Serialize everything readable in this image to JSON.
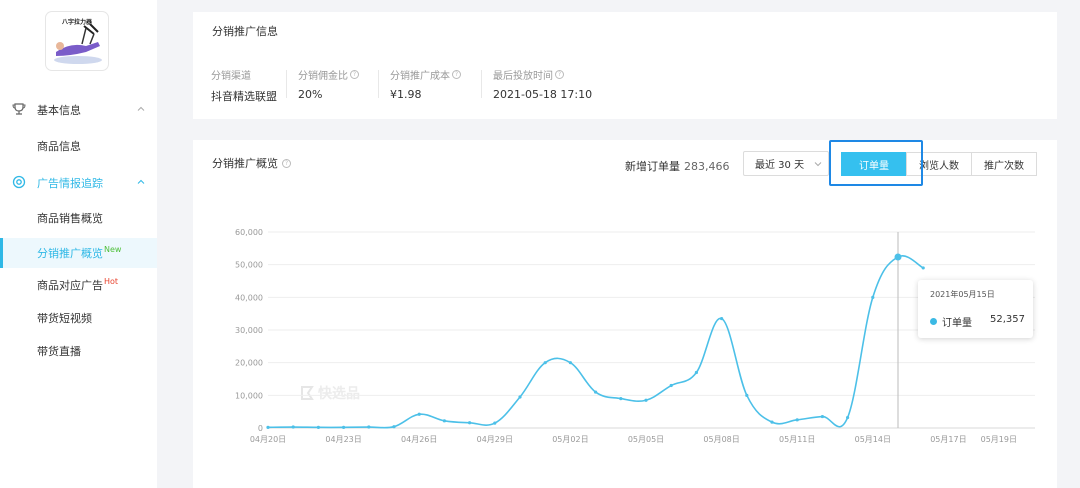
{
  "sidebar": {
    "product_thumb_label": "八字拉力器",
    "groups": [
      {
        "label": "基本信息",
        "icon": "trophy-icon",
        "color": "#333333"
      },
      {
        "label": "广告情报追踪",
        "icon": "target-icon",
        "color": "#2fb8e6"
      }
    ],
    "items": [
      {
        "label": "商品信息"
      },
      {
        "label": "商品销售概览"
      },
      {
        "label": "分销推广概览",
        "badge": "New"
      },
      {
        "label": "商品对应广告",
        "badge": "Hot"
      },
      {
        "label": "带货短视频"
      },
      {
        "label": "带货直播"
      }
    ]
  },
  "info": {
    "title": "分销推广信息",
    "columns": [
      {
        "key": "分销渠道",
        "value": "抖音精选联盟",
        "help": false
      },
      {
        "key": "分销佣金比",
        "value": "20%",
        "help": true
      },
      {
        "key": "分销推广成本",
        "value": "¥1.98",
        "help": true
      },
      {
        "key": "最后投放时间",
        "value": "2021-05-18 17:10",
        "help": true
      }
    ]
  },
  "overview": {
    "title": "分销推广概览",
    "stat_label": "新增订单量",
    "stat_value": "283,466",
    "period": "最近 30 天",
    "tabs": [
      "订单量",
      "浏览人数",
      "推广次数"
    ],
    "selected_tab": 0
  },
  "tooltip": {
    "date": "2021年05月15日",
    "series": "订单量",
    "value": "52,357"
  },
  "watermark": "快选品",
  "colors": {
    "accent": "#35c0ef",
    "line": "#4cc0e8",
    "highlight": "#1e88e5"
  },
  "chart_data": {
    "type": "line",
    "x": [
      "04月20日",
      "04月21日",
      "04月22日",
      "04月23日",
      "04月24日",
      "04月25日",
      "04月26日",
      "04月27日",
      "04月28日",
      "04月29日",
      "04月30日",
      "05月01日",
      "05月02日",
      "05月03日",
      "05月04日",
      "05月05日",
      "05月06日",
      "05月07日",
      "05月08日",
      "05月09日",
      "05月10日",
      "05月11日",
      "05月12日",
      "05月13日",
      "05月14日",
      "05月15日",
      "05月16日"
    ],
    "x_ticks": [
      "04月20日",
      "04月23日",
      "04月26日",
      "04月29日",
      "05月02日",
      "05月05日",
      "05月08日",
      "05月11日",
      "05月14日",
      "05月17日",
      "05月19日"
    ],
    "series": [
      {
        "name": "订单量",
        "values": [
          200,
          300,
          200,
          200,
          300,
          400,
          4200,
          2200,
          1600,
          1500,
          9500,
          20000,
          20000,
          11000,
          9000,
          8500,
          13000,
          17000,
          33500,
          10000,
          1800,
          2500,
          3500,
          3200,
          40000,
          52357,
          49000
        ]
      }
    ],
    "ylim": [
      0,
      60000
    ],
    "y_ticks": [
      "0",
      "10,000",
      "20,000",
      "30,000",
      "40,000",
      "50,000",
      "60,000"
    ],
    "grid": true,
    "tooltip_index": 25
  }
}
